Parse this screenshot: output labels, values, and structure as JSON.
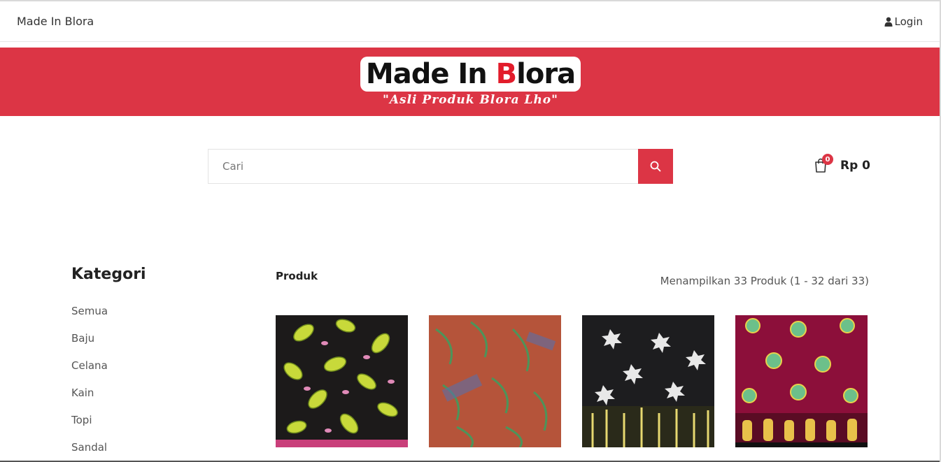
{
  "topbar": {
    "brand": "Made In Blora",
    "login_label": "Login"
  },
  "banner": {
    "logo_text_pre": "Made In ",
    "logo_text_b": "B",
    "logo_text_post": "lora",
    "tagline": "\"Asli Produk Blora Lho\""
  },
  "search": {
    "placeholder": "Cari",
    "value": ""
  },
  "cart": {
    "count": "0",
    "total": "Rp 0"
  },
  "sidebar": {
    "title": "Kategori",
    "items": [
      {
        "label": "Semua"
      },
      {
        "label": "Baju"
      },
      {
        "label": "Celana"
      },
      {
        "label": "Kain"
      },
      {
        "label": "Topi"
      },
      {
        "label": "Sandal"
      }
    ]
  },
  "products": {
    "title": "Produk",
    "count_text": "Menampilkan 33 Produk (1 - 32 dari 33)",
    "items": [
      {
        "pattern": "batik-leaf-black",
        "bg": "#1c1a1a",
        "accent": "#c8d93a"
      },
      {
        "pattern": "batik-orange-leaves",
        "bg": "#b5543a",
        "accent": "#3aa060"
      },
      {
        "pattern": "batik-black-white-leaves",
        "bg": "#1d1d1f",
        "accent": "#e8e8e8"
      },
      {
        "pattern": "batik-red-floral",
        "bg": "#8c0f3a",
        "accent": "#6cc08a"
      }
    ]
  },
  "colors": {
    "accent": "#dc3545"
  }
}
